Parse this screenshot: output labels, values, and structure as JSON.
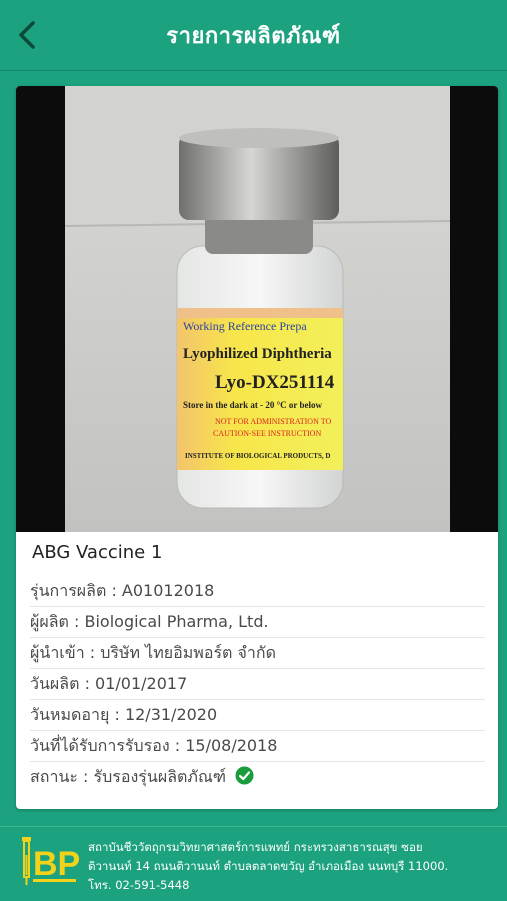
{
  "header": {
    "title": "รายการผลิตภัณฑ์",
    "back_icon": "chevron-left-icon"
  },
  "product": {
    "name": "ABG Vaccine 1",
    "label_lines": [
      "Working Reference Prepa",
      "Lyophilized Diphtheria",
      "Lyo-DX251114",
      "Store in the dark at - 20 °C or below",
      "NOT FOR ADMINISTRATION TO",
      "CAUTION-SEE INSTRUCTION",
      "INSTITUTE OF BIOLOGICAL PRODUCTS, D"
    ],
    "details": [
      "รุ่นการผลิต : A01012018",
      "ผู้ผลิต : Biological Pharma, Ltd.",
      "ผู้นำเข้า : บริษัท ไทยอิมพอร์ต จำกัด",
      "วันผลิต : 01/01/2017",
      "วันหมดอายุ : 12/31/2020",
      "วันที่ได้รับการรับรอง : 15/08/2018",
      "สถานะ : รับรองรุ่นผลิตภัณฑ์"
    ],
    "status_icon": "check-circle-icon",
    "status_color": "#1a9b3c"
  },
  "footer": {
    "logo_text": "BP",
    "address_lines": [
      "สถาบันชีววัตถุกรมวิทยาศาสตร์การแพทย์ กระทรวงสาธารณสุข ซอย",
      "ติวานนท์ 14 ถนนติวานนท์ ตำบลตลาดขวัญ อำเภอเมือง นนทบุรี 11000.",
      "โทร. 02-591-5448"
    ]
  },
  "colors": {
    "primary": "#1ca27e",
    "logo": "#f2d21b"
  }
}
